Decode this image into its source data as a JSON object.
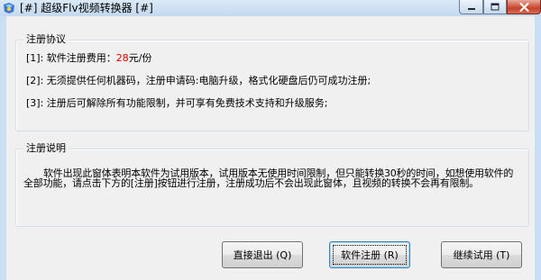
{
  "window": {
    "title": "[#] 超级Flv视频转换器 [#]",
    "icon": "app-logo-icon"
  },
  "agreement": {
    "legend": "注册协议",
    "items": [
      {
        "prefix": "[1]:",
        "text": "软件注册费用：",
        "price": "28",
        "suffix": "元/份"
      },
      {
        "prefix": "[2]:",
        "text": "无须提供任何机器码，注册申请码:电脑升级，格式化硬盘后仍可成功注册;"
      },
      {
        "prefix": "[3]:",
        "text": "注册后可解除所有功能限制，并可享有免费技术支持和升级服务;"
      }
    ],
    "price_color": "#e60000"
  },
  "notice": {
    "legend": "注册说明",
    "text": "软件出现此窗体表明本软件为试用版本，试用版本无使用时间限制，但只能转换30秒的时间，如想使用软件的全部功能，请点击下方的[注册]按钮进行注册，注册成功后不会出现此窗体，且视频的转换不会再有限制。"
  },
  "buttons": {
    "exit": "直接退出 (Q)",
    "register": "软件注册 (R)",
    "trial": "继续试用 (T)"
  }
}
